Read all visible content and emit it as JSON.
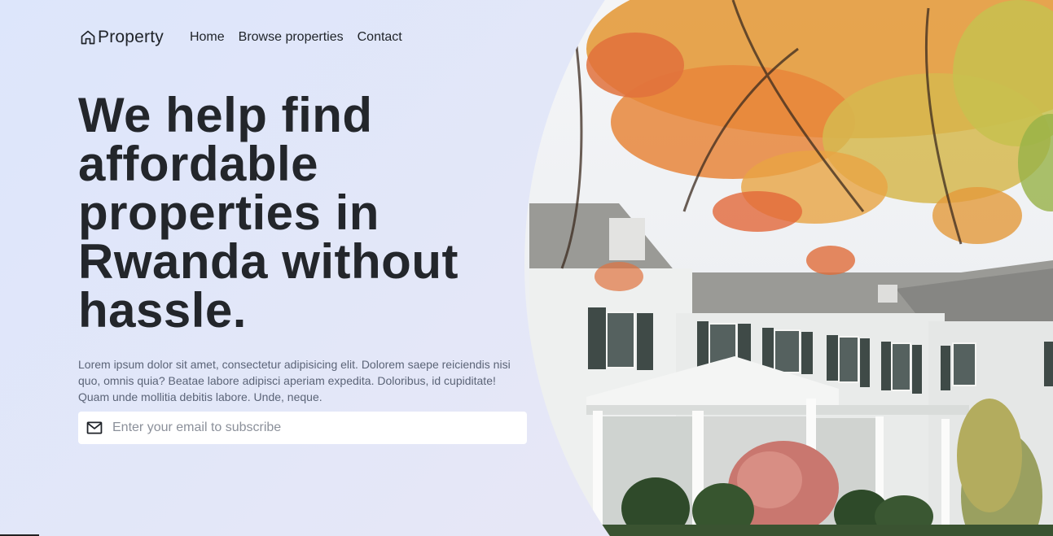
{
  "brand": {
    "name": "Property",
    "icon": "home-icon"
  },
  "nav": {
    "items": [
      {
        "label": "Home"
      },
      {
        "label": "Browse properties"
      },
      {
        "label": "Contact"
      }
    ]
  },
  "hero": {
    "headline": "We help find affordable properties in Rwanda without hassle.",
    "description": "Lorem ipsum dolor sit amet, consectetur adipisicing elit. Dolorem saepe reiciendis nisi quo, omnis quia? Beatae labore adipisci aperiam expedita. Doloribus, id cupiditate! Quam unde mollitia debitis labore. Unde, neque.",
    "image": "white-colonial-house-with-autumn-maple-tree"
  },
  "subscribe": {
    "icon": "mail-icon",
    "value": "",
    "placeholder": "Enter your email to subscribe"
  }
}
